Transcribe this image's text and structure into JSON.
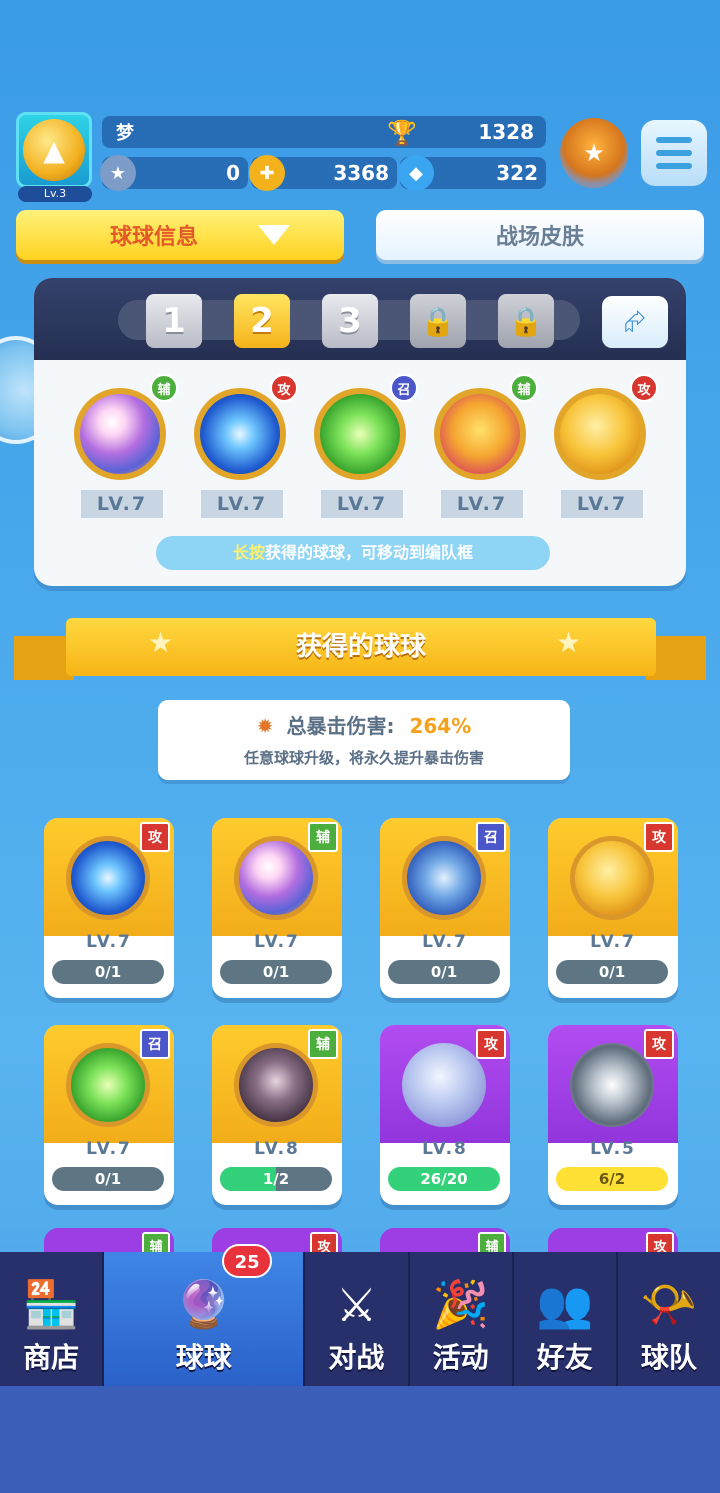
{
  "player": {
    "name": "梦",
    "level": "Lv.3",
    "trophies": "1328",
    "stars": "0",
    "coins": "3368",
    "gems": "322"
  },
  "tabs": {
    "info": "球球信息",
    "skin": "战场皮肤"
  },
  "team": {
    "slots": [
      "1",
      "2",
      "3",
      "lock",
      "lock"
    ],
    "active_slot": 2,
    "balls": [
      {
        "tag": "辅",
        "level": "LV.7",
        "type": "aux",
        "orb": "rainbow"
      },
      {
        "tag": "攻",
        "level": "LV.7",
        "type": "atk",
        "orb": "blue"
      },
      {
        "tag": "召",
        "level": "LV.7",
        "type": "sum",
        "orb": "green"
      },
      {
        "tag": "辅",
        "level": "LV.7",
        "type": "aux",
        "orb": "jelly"
      },
      {
        "tag": "攻",
        "level": "LV.7",
        "type": "atk",
        "orb": "gold"
      }
    ],
    "hint_key": "长按",
    "hint_rest": "获得的球球，可移动到编队框"
  },
  "collection": {
    "title": "获得的球球",
    "crit_label": "总暴击伤害:",
    "crit_value": "264%",
    "crit_sub": "任意球球升级，将永久提升暴击伤害",
    "cards": [
      {
        "tag": "攻",
        "type": "atk",
        "level": "LV.7",
        "progress": "0/1",
        "ratio": 0,
        "color": "gold",
        "orb": "blue"
      },
      {
        "tag": "辅",
        "type": "aux",
        "level": "LV.7",
        "progress": "0/1",
        "ratio": 0,
        "color": "gold",
        "orb": "rainbow"
      },
      {
        "tag": "召",
        "type": "sum",
        "level": "LV.7",
        "progress": "0/1",
        "ratio": 0,
        "color": "gold",
        "orb": "storm"
      },
      {
        "tag": "攻",
        "type": "atk",
        "level": "LV.7",
        "progress": "0/1",
        "ratio": 0,
        "color": "gold",
        "orb": "gold"
      },
      {
        "tag": "召",
        "type": "sum",
        "level": "LV.7",
        "progress": "0/1",
        "ratio": 0,
        "color": "gold",
        "orb": "green"
      },
      {
        "tag": "辅",
        "type": "aux",
        "level": "LV.8",
        "progress": "1/2",
        "ratio": 0.5,
        "color": "gold",
        "orb": "skull"
      },
      {
        "tag": "攻",
        "type": "atk",
        "level": "LV.8",
        "progress": "26/20",
        "ratio": 1,
        "color": "purple",
        "orb": "moon"
      },
      {
        "tag": "攻",
        "type": "atk",
        "level": "LV.5",
        "progress": "6/2",
        "ratio": 1,
        "color": "purple",
        "orb": "swirl",
        "ready": true
      }
    ],
    "peek_tags": [
      "辅",
      "攻",
      "辅",
      "攻"
    ]
  },
  "nav": {
    "shop": "商店",
    "balls": "球球",
    "balls_badge": "25",
    "battle": "对战",
    "events": "活动",
    "friends": "好友",
    "team": "球队"
  },
  "icons": {
    "avatar": "ball-avatar-icon",
    "trophy": "trophy-icon",
    "star_add": "star-plus-icon",
    "coin_add": "coin-plus-icon",
    "gem_add": "gem-plus-icon",
    "rank": "rank-medal-icon",
    "menu": "menu-icon",
    "share": "share-icon",
    "lock": "lock-icon"
  },
  "colors": {
    "accent_yellow": "#ffd21f",
    "attack_red": "#d7372f",
    "aux_green": "#4cae3c",
    "summon_blue": "#4b56c8",
    "nav_bg": "#27306a"
  }
}
